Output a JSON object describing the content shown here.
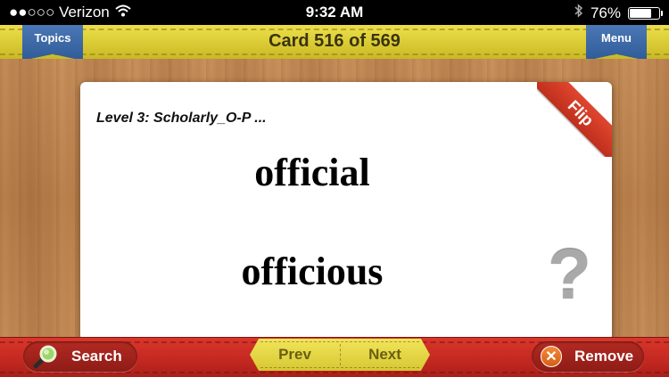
{
  "status_bar": {
    "carrier": "●●○○○ Verizon",
    "time": "9:32 AM",
    "battery_percent_text": "76%",
    "battery_level": 0.76,
    "icons": {
      "wifi": "wifi-icon",
      "bluetooth": "bluetooth-icon",
      "battery": "battery-icon"
    }
  },
  "header": {
    "topics_label": "Topics",
    "menu_label": "Menu",
    "card_counter": "Card 516 of 569"
  },
  "card": {
    "level": "Level 3: Scholarly_O-P ...",
    "word1": "official",
    "word2": "officious",
    "flip_label": "Flip",
    "question_mark": "?"
  },
  "footer": {
    "search_label": "Search",
    "prev_label": "Prev",
    "next_label": "Next",
    "remove_label": "Remove",
    "remove_icon_glyph": "✕"
  },
  "colors": {
    "top_bar": "#d8c933",
    "bottom_bar": "#c22820",
    "ribbon": "#2f5b97",
    "flip": "#d23a26"
  }
}
